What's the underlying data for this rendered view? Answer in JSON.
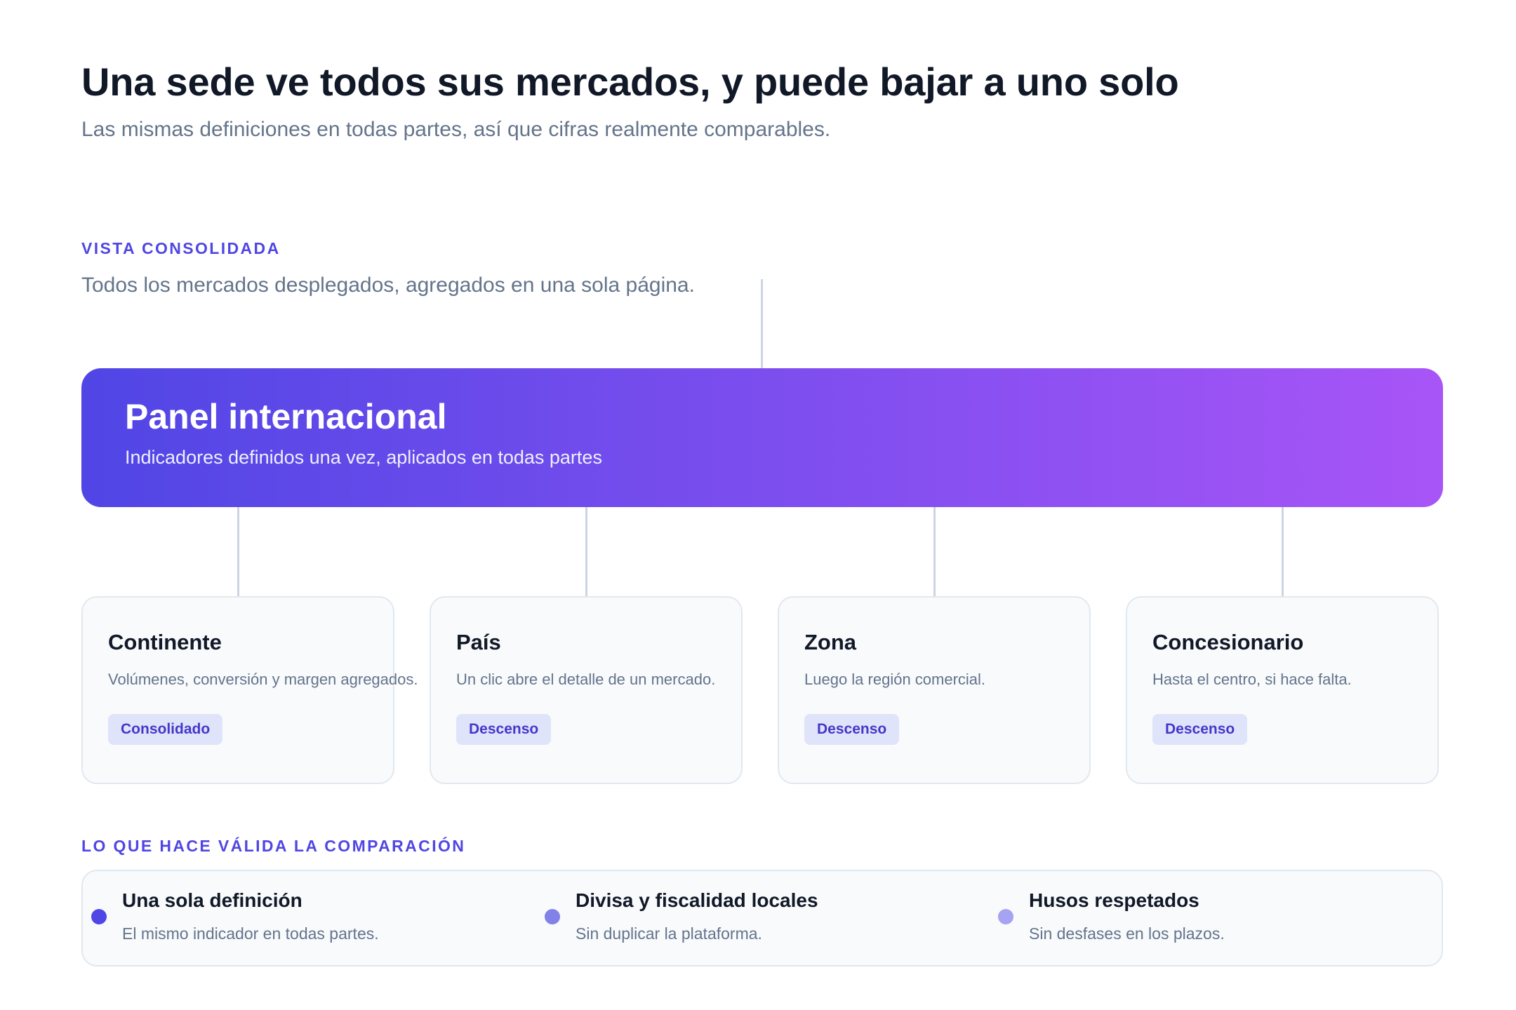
{
  "header": {
    "title": "Una sede ve todos sus mercados, y puede bajar a uno solo",
    "subtitle": "Las mismas definiciones en todas partes, así que cifras realmente comparables."
  },
  "consolidated": {
    "kicker": "VISTA CONSOLIDADA",
    "description": "Todos los mercados desplegados, agregados en una sola página."
  },
  "panel": {
    "title": "Panel internacional",
    "subtitle": "Indicadores definidos una vez, aplicados en todas partes",
    "gradient": [
      "#5046e5",
      "#a855f7"
    ]
  },
  "levels": [
    {
      "title": "Continente",
      "description": "Volúmenes, conversión y margen agregados.",
      "badge": "Consolidado"
    },
    {
      "title": "País",
      "description": "Un clic abre el detalle de un mercado.",
      "badge": "Descenso"
    },
    {
      "title": "Zona",
      "description": "Luego la región comercial.",
      "badge": "Descenso"
    },
    {
      "title": "Concesionario",
      "description": "Hasta el centro, si hace falta.",
      "badge": "Descenso"
    }
  ],
  "comparison": {
    "kicker": "LO QUE HACE VÁLIDA LA COMPARACIÓN",
    "items": [
      {
        "title": "Una sola definición",
        "description": "El mismo indicador en todas partes.",
        "dot_color": "#5046e5"
      },
      {
        "title": "Divisa y fiscalidad locales",
        "description": "Sin duplicar la plataforma.",
        "dot_color": "#8181e8"
      },
      {
        "title": "Husos respetados",
        "description": "Sin desfases en los plazos.",
        "dot_color": "#a5a3f2"
      }
    ]
  }
}
